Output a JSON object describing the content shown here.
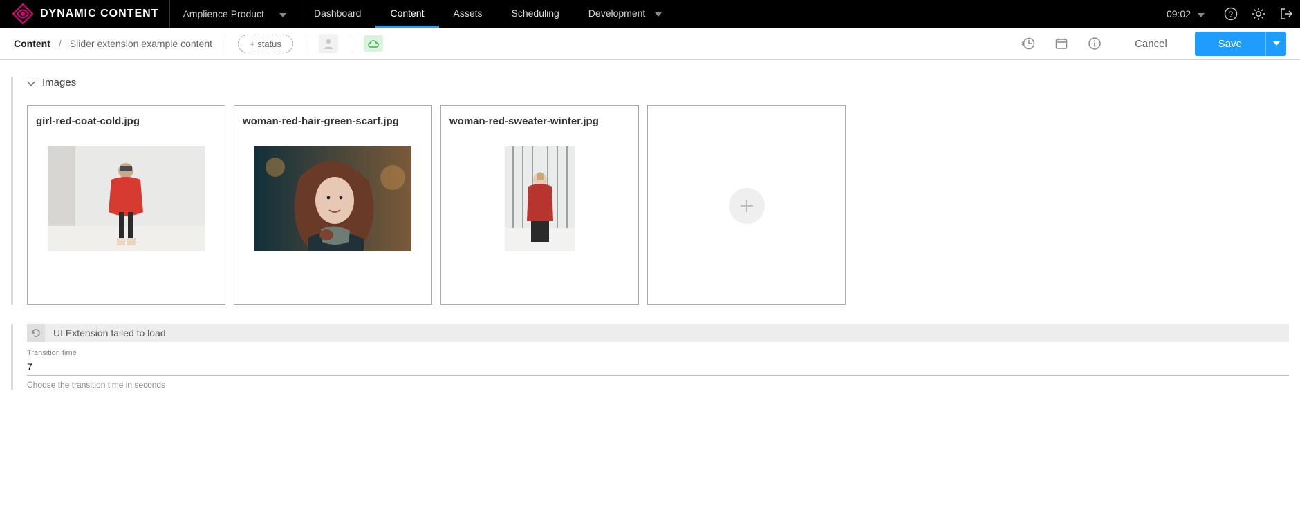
{
  "brand": {
    "logo_text": "DYNAMIC CONTENT"
  },
  "hub": {
    "name": "Amplience Product"
  },
  "nav": {
    "items": [
      "Dashboard",
      "Content",
      "Assets",
      "Scheduling",
      "Development"
    ],
    "active_index": 1
  },
  "clock": {
    "time": "09:02"
  },
  "top_icons": {
    "help": "help-icon",
    "settings": "gear-icon",
    "exit": "exit-icon"
  },
  "breadcrumb": {
    "root": "Content",
    "separator": "/",
    "leaf": "Slider extension example content"
  },
  "status_chip": {
    "label": "+ status"
  },
  "actions": {
    "cancel": "Cancel",
    "save": "Save"
  },
  "sub_icons": {
    "history": "history-icon",
    "schedule": "calendar-icon",
    "info": "info-icon"
  },
  "sync": {
    "tooltip": "Published"
  },
  "images_section": {
    "title": "Images",
    "items": [
      {
        "filename": "girl-red-coat-cold.jpg",
        "thumb_style": "landscape-1"
      },
      {
        "filename": "woman-red-hair-green-scarf.jpg",
        "thumb_style": "landscape-2"
      },
      {
        "filename": "woman-red-sweater-winter.jpg",
        "thumb_style": "portrait-3"
      }
    ],
    "add_tooltip": "Add image"
  },
  "extension": {
    "error": "UI Extension failed to load",
    "field_label": "Transition time",
    "field_value": "7",
    "field_help": "Choose the transition time in seconds"
  },
  "colors": {
    "accent": "#1e9dff",
    "pink": "#e6007e"
  }
}
